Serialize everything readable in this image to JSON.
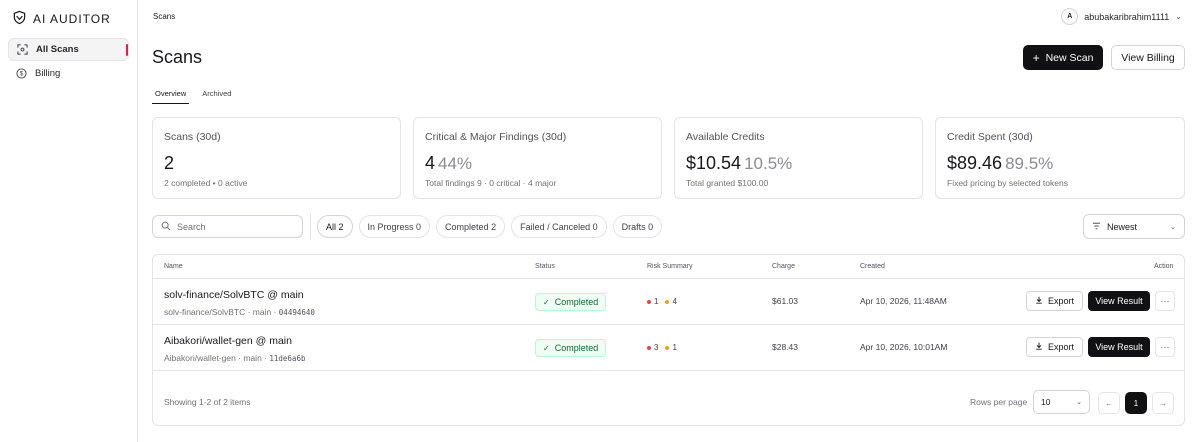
{
  "app": {
    "brand": "AI AUDITOR"
  },
  "sidebar": {
    "items": [
      {
        "label": "All Scans",
        "icon": "scan-icon",
        "active": true
      },
      {
        "label": "Billing",
        "icon": "dollar-circle-icon",
        "active": false
      }
    ]
  },
  "header": {
    "breadcrumb": "Scans",
    "user_initial": "A",
    "username": "abubakaribrahim1111",
    "title": "Scans",
    "new_scan_label": "New Scan",
    "view_billing_label": "View Billing"
  },
  "tabs": [
    {
      "label": "Overview",
      "active": true
    },
    {
      "label": "Archived",
      "active": false
    }
  ],
  "stats": [
    {
      "title": "Scans (30d)",
      "value": "2",
      "pct": "",
      "sub": "2 completed • 0 active"
    },
    {
      "title": "Critical & Major Findings (30d)",
      "value": "4",
      "pct": "44%",
      "sub": "Total findings 9 · 0 critical · 4 major"
    },
    {
      "title": "Available Credits",
      "value": "$10.54",
      "pct": "10.5%",
      "sub": "Total granted $100.00"
    },
    {
      "title": "Credit Spent (30d)",
      "value": "$89.46",
      "pct": "89.5%",
      "sub": "Fixed pricing by selected tokens"
    }
  ],
  "filters": {
    "search_placeholder": "Search",
    "chips": [
      {
        "label": "All 2",
        "active": true
      },
      {
        "label": "In Progress 0",
        "active": false
      },
      {
        "label": "Completed 2",
        "active": false
      },
      {
        "label": "Failed / Canceled 0",
        "active": false
      },
      {
        "label": "Drafts 0",
        "active": false
      }
    ],
    "sort_label": "Newest"
  },
  "table": {
    "headers": {
      "name": "Name",
      "status": "Status",
      "risk": "Risk Summary",
      "charge": "Charge",
      "created": "Created",
      "action": "Action"
    },
    "rows": [
      {
        "title": "solv-finance/SolvBTC @ main",
        "sub": "solv-finance/SolvBTC · main · ",
        "hash": "04494640",
        "status": "Completed",
        "risk_major": "1",
        "risk_minor": "4",
        "charge": "$61.03",
        "created": "Apr 10, 2026, 11:48AM",
        "export_label": "Export",
        "view_label": "View Result"
      },
      {
        "title": "Aibakori/wallet-gen @ main",
        "sub": "Aibakori/wallet-gen · main · ",
        "hash": "11de6a6b",
        "status": "Completed",
        "risk_major": "3",
        "risk_minor": "1",
        "charge": "$28.43",
        "created": "Apr 10, 2026, 10:01AM",
        "export_label": "Export",
        "view_label": "View Result"
      }
    ],
    "footer": {
      "showing": "Showing 1-2 of 2 items",
      "rows_per_page_label": "Rows per page",
      "rows_per_page": "10",
      "current_page": "1",
      "prev_label": "←",
      "next_label": "→"
    }
  },
  "colors": {
    "risk_major": "#ef4444",
    "risk_minor": "#f59e0b",
    "status_green": "#166534",
    "accent_red": "#e11d48"
  }
}
